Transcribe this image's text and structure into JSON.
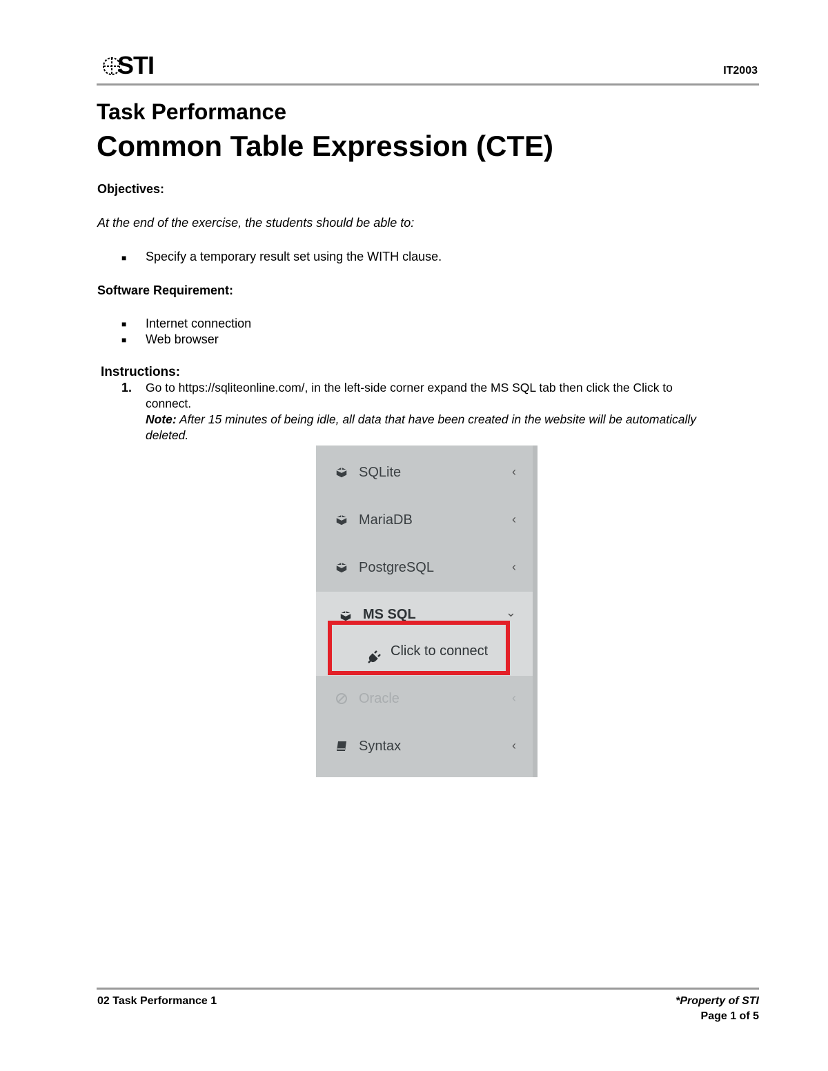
{
  "header": {
    "logo_text": "STI",
    "course_code": "IT2003"
  },
  "doc": {
    "subtitle": "Task Performance",
    "title": "Common Table Expression (CTE)",
    "objectives_heading": "Objectives:",
    "objectives_intro": "At the end of the exercise, the students should be able to:",
    "objectives": [
      "Specify a temporary result set using the WITH clause."
    ],
    "software_heading": "Software Requirement:",
    "software": [
      "Internet connection",
      "Web browser"
    ],
    "instructions_heading": "Instructions:",
    "step1_number": "1.",
    "step1_line1": "Go to https://sqliteonline.com/, in the left-side corner expand the MS SQL tab then click the Click to",
    "step1_line2": "connect.",
    "note_label": "Note:",
    "note_line1": " After 15 minutes of being idle, all data that have been created in the website will be automatically",
    "note_line2": "deleted."
  },
  "screenshot": {
    "items": [
      {
        "label": "SQLite",
        "icon": "cube-icon",
        "chevron": "‹"
      },
      {
        "label": "MariaDB",
        "icon": "cube-icon",
        "chevron": "‹"
      },
      {
        "label": "PostgreSQL",
        "icon": "cube-icon",
        "chevron": "‹"
      },
      {
        "label": "MS SQL",
        "icon": "cube-icon",
        "chevron": "⌄"
      },
      {
        "label": "Click to connect",
        "icon": "plug-icon"
      },
      {
        "label": "Oracle",
        "icon": "ban-icon",
        "chevron": "‹"
      },
      {
        "label": "Syntax",
        "icon": "book-icon",
        "chevron": "‹"
      }
    ],
    "highlight_color": "#e32028"
  },
  "footer": {
    "left": "02 Task Performance 1",
    "right": "*Property of STI",
    "page": "Page 1 of 5"
  }
}
